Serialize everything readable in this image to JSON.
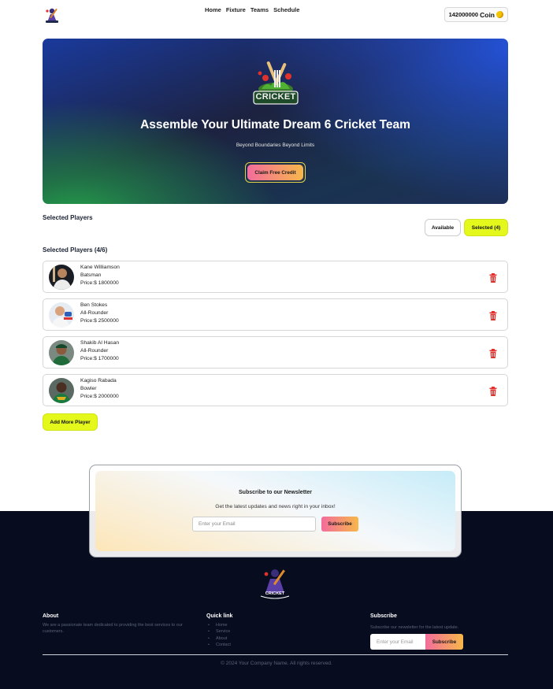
{
  "nav": {
    "links": [
      "Home",
      "Fixture",
      "Teams",
      "Schedule"
    ],
    "coin_amount": "142000000",
    "coin_label": "Coin",
    "coin_icon": "coin-stack-icon"
  },
  "hero": {
    "logo_text": "CRICKET",
    "title": "Assemble Your Ultimate Dream 6 Cricket Team",
    "subtitle": "Beyond Boundaries Beyond Limits",
    "cta": "Claim Free Credit"
  },
  "selection": {
    "section_title": "Selected Players",
    "toggle_available": "Available",
    "toggle_selected": "Selected (4)",
    "count_title": "Selected Players (4/6)",
    "players": [
      {
        "name": "Kane Williamson",
        "role": "Batsman",
        "price": "Price:$ 1800000"
      },
      {
        "name": "Ben Stokes",
        "role": "All-Rounder",
        "price": "Price:$ 2500000"
      },
      {
        "name": "Shakib Al Hasan",
        "role": "All-Rounder",
        "price": "Price:$ 1700000"
      },
      {
        "name": "Kagiso Rabada",
        "role": "Bowler",
        "price": "Price:$ 2000000"
      }
    ],
    "add_more": "Add More Player"
  },
  "newsletter": {
    "title": "Subscribe to our Newsletter",
    "subtitle": "Get the latest updates and news right in your inbox!",
    "placeholder": "Enter your Email",
    "button": "Subscribe"
  },
  "footer": {
    "logo_text": "CRICKET",
    "about_title": "About",
    "about_text": "We are a passionate team dedicated to providing the best services to our customers.",
    "quick_title": "Quick link",
    "quick_links": [
      "Home",
      "Service",
      "About",
      "Contact"
    ],
    "subscribe_title": "Subscribe",
    "subscribe_text": "Subscribe our newsletter for the latest update.",
    "subscribe_placeholder": "Enter your Email",
    "subscribe_button": "Subscribe",
    "copyright": "© 2024 Your Company Name. All rights reserved."
  },
  "colors": {
    "accent_lime": "#e4f81c",
    "gradient_pink": "#f36c9c",
    "gradient_orange": "#f7b74a",
    "footer_bg": "#070c1f",
    "delete_red": "#e0322c"
  }
}
